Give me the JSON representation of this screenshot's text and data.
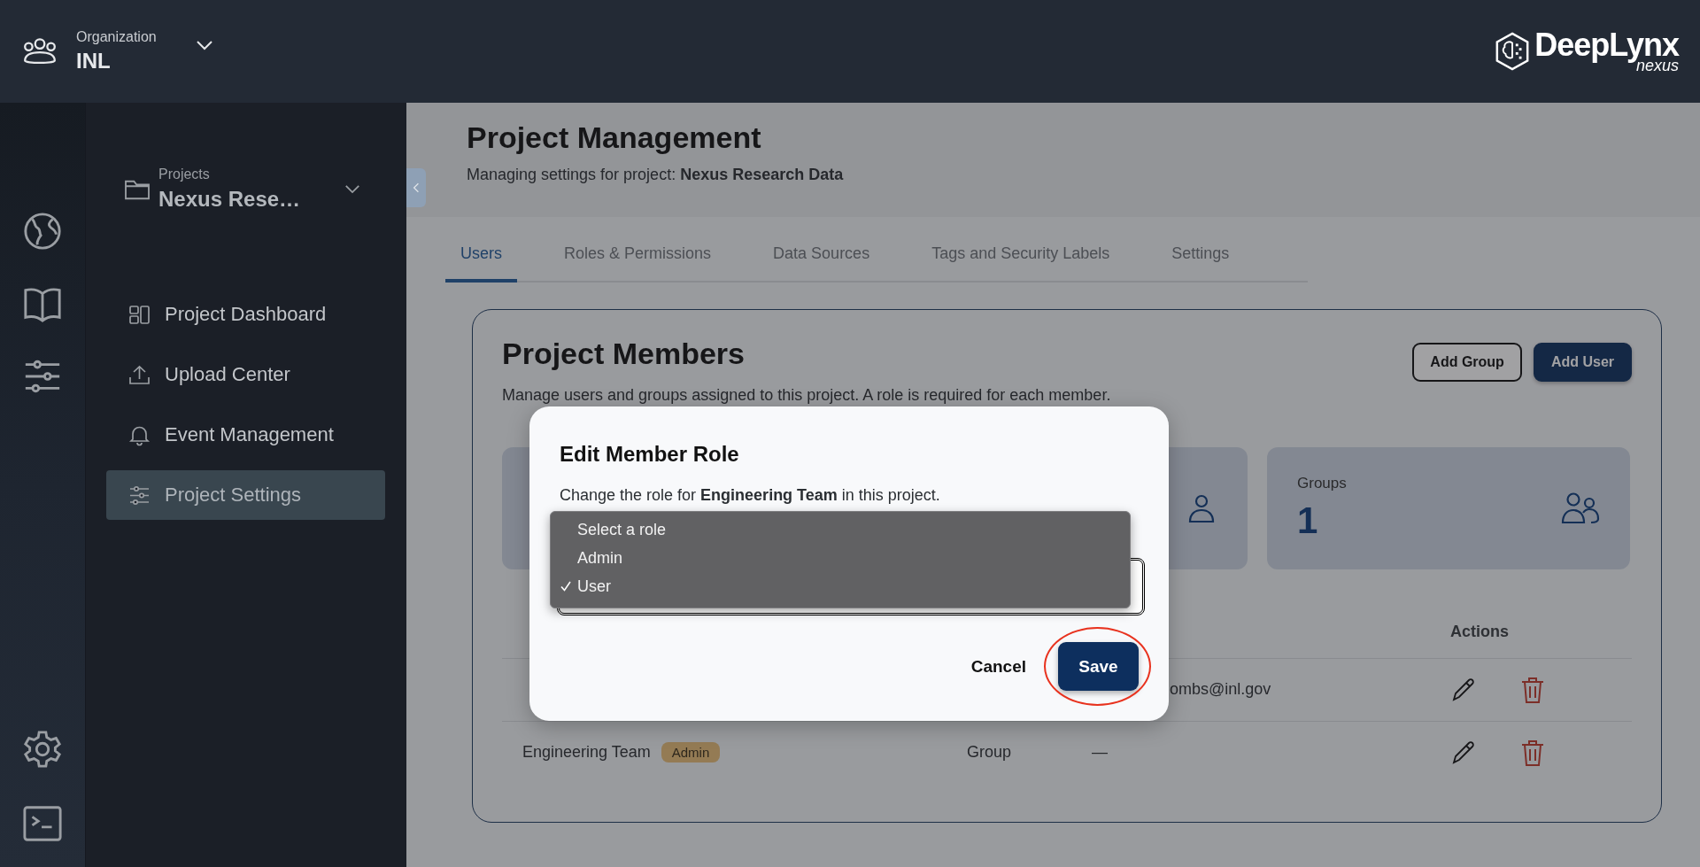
{
  "org": {
    "label": "Organization",
    "name": "INL"
  },
  "logo": {
    "name": "DeepLynx",
    "sub": "nexus"
  },
  "project_picker": {
    "label": "Projects",
    "value": "Nexus Rese…"
  },
  "nav": [
    {
      "label": "Project Dashboard",
      "selected": false
    },
    {
      "label": "Upload Center",
      "selected": false
    },
    {
      "label": "Event Management",
      "selected": false
    },
    {
      "label": "Project Settings",
      "selected": true
    }
  ],
  "header": {
    "title": "Project Management",
    "subtitle": "Managing settings for project: **Nexus Research Data**"
  },
  "tabs": [
    {
      "label": "Users",
      "selected": true
    },
    {
      "label": "Roles & Permissions",
      "selected": false
    },
    {
      "label": "Data Sources",
      "selected": false
    },
    {
      "label": "Tags and Security Labels",
      "selected": false
    },
    {
      "label": "Settings",
      "selected": false
    }
  ],
  "members": {
    "title": "Project Members",
    "description": "Manage users and groups assigned to this project. A role is required for each member.",
    "buttons": [
      {
        "label": "Add Group",
        "kind": "outline"
      },
      {
        "label": "Add User",
        "kind": "primary"
      }
    ],
    "stats": [
      {
        "label": "Groups",
        "value": "1"
      }
    ]
  },
  "table": {
    "columns": [
      {
        "label": "Actions"
      }
    ],
    "rows": [
      {
        "email": "ombs@inl.gov"
      },
      {
        "name": "Engineering Team",
        "badge": "Admin",
        "type": "Group",
        "email": "—"
      }
    ]
  },
  "dialog": {
    "title": "Edit Member Role",
    "text": "Change the role for **Engineering Team** in this project.",
    "options": [
      {
        "label": "Select a role",
        "selected": false
      },
      {
        "label": "Admin",
        "selected": false
      },
      {
        "label": "User",
        "selected": true
      }
    ],
    "buttons": [
      {
        "label": "Cancel",
        "kind": "text",
        "highlighted": false
      },
      {
        "label": "Save",
        "kind": "primary",
        "highlighted": true
      }
    ]
  }
}
